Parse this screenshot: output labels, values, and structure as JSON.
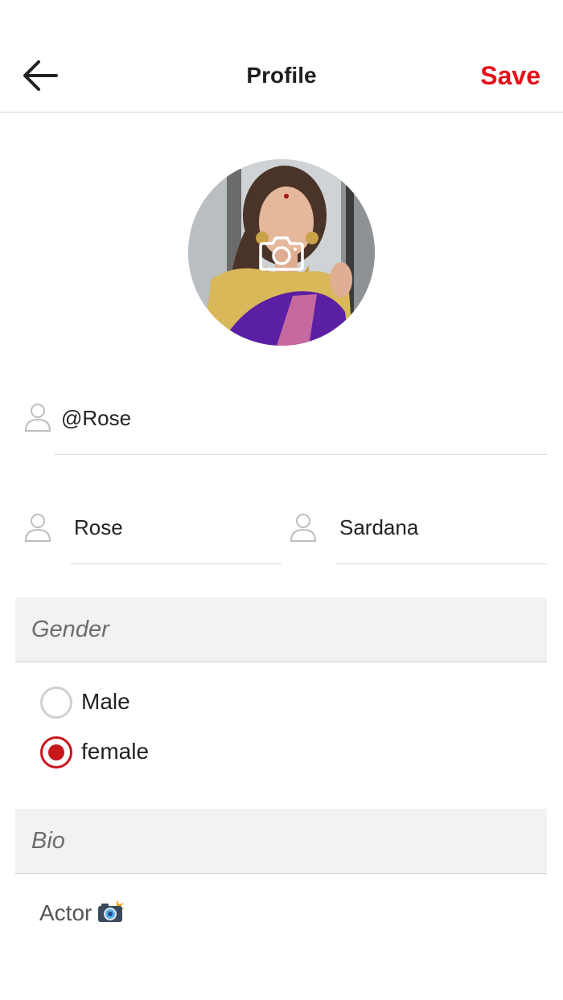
{
  "header": {
    "title": "Profile",
    "save_label": "Save"
  },
  "profile": {
    "username": "@Rose",
    "first_name": "Rose",
    "last_name": "Sardana"
  },
  "gender": {
    "section_label": "Gender",
    "options": [
      {
        "label": "Male",
        "selected": false
      },
      {
        "label": "female",
        "selected": true
      }
    ]
  },
  "bio": {
    "section_label": "Bio",
    "text": "Actor",
    "emoji": "camera-with-flash-icon"
  },
  "colors": {
    "accent": "#e3101a",
    "radio_selected": "#c8161d",
    "section_bg": "#f2f2f2"
  }
}
